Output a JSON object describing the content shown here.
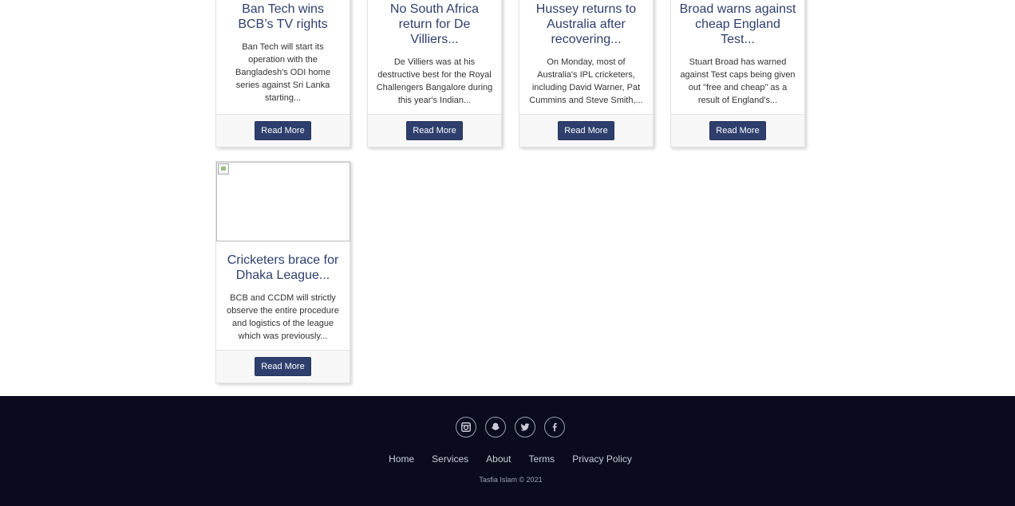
{
  "cards": [
    {
      "title": "Ban Tech wins BCB’s TV rights",
      "text": "Ban Tech will start its operation with the Bangladesh's ODI home series against Sri Lanka starting...",
      "button": "Read More"
    },
    {
      "title": "No South Africa return for De Villiers...",
      "text": "De Villiers was at his destructive best for the Royal Challengers Bangalore during this year's Indian...",
      "button": "Read More"
    },
    {
      "title": "Hussey returns to Australia after recovering...",
      "text": "On Monday, most of Australia's IPL cricketers, including David Warner, Pat Cummins and Steve Smith,...",
      "button": "Read More"
    },
    {
      "title": "Broad warns against cheap England Test...",
      "text": "Stuart Broad has warned against Test caps being given out \"free and cheap\" as a result of England's...",
      "button": "Read More"
    },
    {
      "title": "Cricketers brace for Dhaka League...",
      "text": "BCB and CCDM will strictly observe the entire procedure and logistics of the league which was previously...",
      "button": "Read More"
    }
  ],
  "footer": {
    "socials": [
      "instagram-icon",
      "snapchat-icon",
      "twitter-icon",
      "facebook-icon"
    ],
    "links": [
      "Home",
      "Services",
      "About",
      "Terms",
      "Privacy Policy"
    ],
    "copyright": "Tasfia Islam © 2021"
  },
  "colors": {
    "accent": "#2e3f6e",
    "footer_bg": "#0a0c1e"
  }
}
